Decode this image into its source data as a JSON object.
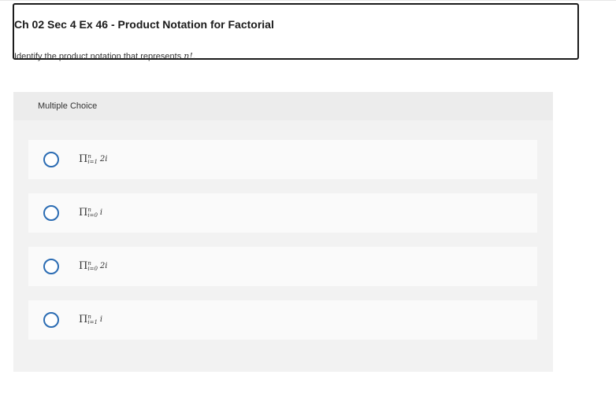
{
  "header": {
    "title": "Ch 02 Sec 4 Ex 46 - Product Notation for Factorial",
    "prompt_prefix": "Identify the product notation that represents ",
    "prompt_math": "n!",
    "prompt_suffix": "."
  },
  "question": {
    "type_label": "Multiple Choice",
    "options": [
      {
        "symbol": "Π",
        "upper": "n",
        "lower": "i=1",
        "term": "2i"
      },
      {
        "symbol": "Π",
        "upper": "n",
        "lower": "i=0",
        "term": "i"
      },
      {
        "symbol": "Π",
        "upper": "n",
        "lower": "i=0",
        "term": "2i"
      },
      {
        "symbol": "Π",
        "upper": "n",
        "lower": "i=1",
        "term": "i"
      }
    ]
  },
  "colors": {
    "radio_border": "#2b6cb3",
    "panel_bg": "#f2f2f2",
    "option_bg": "#fafafa"
  }
}
